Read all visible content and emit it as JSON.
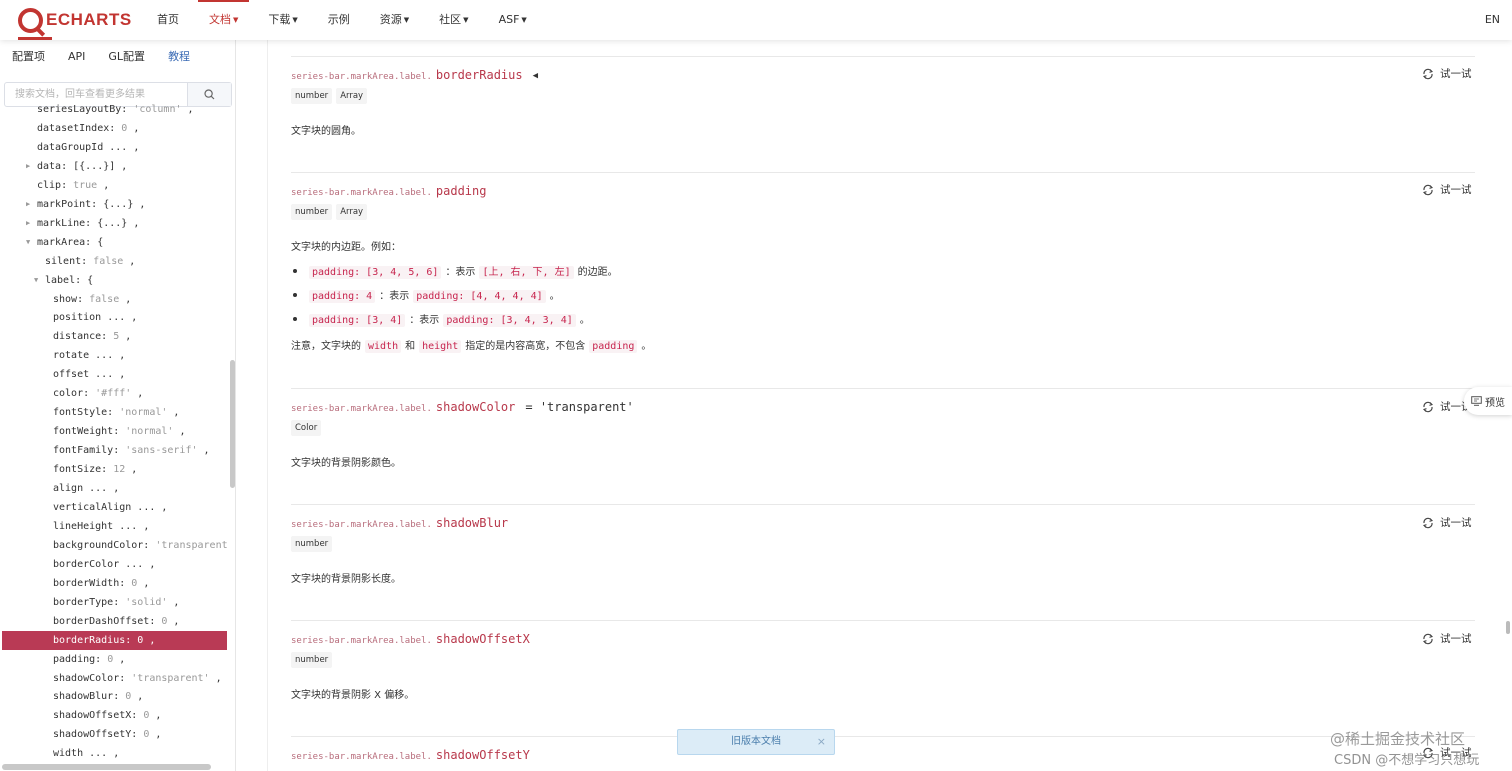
{
  "nav": {
    "logo_text": "ECHARTS",
    "items": [
      {
        "label": "首页",
        "has_caret": false
      },
      {
        "label": "文档",
        "has_caret": true
      },
      {
        "label": "下载",
        "has_caret": true
      },
      {
        "label": "示例",
        "has_caret": false
      },
      {
        "label": "资源",
        "has_caret": true
      },
      {
        "label": "社区",
        "has_caret": true
      },
      {
        "label": "ASF",
        "has_caret": true
      }
    ],
    "active_index": 1,
    "lang": "EN",
    "accent_color": "#c23531"
  },
  "sidebar": {
    "tabs": [
      "配置项",
      "API",
      "GL配置",
      "教程"
    ],
    "active_tab_index": 3,
    "search_placeholder": "搜索文档，回车查看更多结果",
    "tree": [
      {
        "key": "seriesLayoutBy:",
        "value": "'column'",
        "suffix": ",",
        "level": 0,
        "arrow": ""
      },
      {
        "key": "datasetIndex:",
        "value": "0",
        "suffix": ",",
        "level": 0,
        "arrow": ""
      },
      {
        "key": "dataGroupId",
        "value": "...",
        "suffix": ",",
        "level": 0,
        "arrow": ""
      },
      {
        "key": "data:",
        "value": "[{...}]",
        "suffix": ",",
        "level": 0,
        "arrow": "right"
      },
      {
        "key": "clip:",
        "value": "true",
        "suffix": ",",
        "level": 0,
        "arrow": ""
      },
      {
        "key": "markPoint:",
        "value": "{...}",
        "suffix": ",",
        "level": 0,
        "arrow": "right"
      },
      {
        "key": "markLine:",
        "value": "{...}",
        "suffix": ",",
        "level": 0,
        "arrow": "right"
      },
      {
        "key": "markArea:",
        "value": "{",
        "suffix": "",
        "level": 0,
        "arrow": "down"
      },
      {
        "key": "silent:",
        "value": "false",
        "suffix": ",",
        "level": 1,
        "arrow": ""
      },
      {
        "key": "label:",
        "value": "{",
        "suffix": "",
        "level": 1,
        "arrow": "down"
      },
      {
        "key": "show:",
        "value": "false",
        "suffix": ",",
        "level": 2,
        "arrow": ""
      },
      {
        "key": "position",
        "value": "...",
        "suffix": ",",
        "level": 2,
        "arrow": ""
      },
      {
        "key": "distance:",
        "value": "5",
        "suffix": ",",
        "level": 2,
        "arrow": ""
      },
      {
        "key": "rotate",
        "value": "...",
        "suffix": ",",
        "level": 2,
        "arrow": ""
      },
      {
        "key": "offset",
        "value": "...",
        "suffix": ",",
        "level": 2,
        "arrow": ""
      },
      {
        "key": "color:",
        "value": "'#fff'",
        "suffix": ",",
        "level": 2,
        "arrow": ""
      },
      {
        "key": "fontStyle:",
        "value": "'normal'",
        "suffix": ",",
        "level": 2,
        "arrow": ""
      },
      {
        "key": "fontWeight:",
        "value": "'normal'",
        "suffix": ",",
        "level": 2,
        "arrow": ""
      },
      {
        "key": "fontFamily:",
        "value": "'sans-serif'",
        "suffix": ",",
        "level": 2,
        "arrow": ""
      },
      {
        "key": "fontSize:",
        "value": "12",
        "suffix": ",",
        "level": 2,
        "arrow": ""
      },
      {
        "key": "align",
        "value": "...",
        "suffix": ",",
        "level": 2,
        "arrow": ""
      },
      {
        "key": "verticalAlign",
        "value": "...",
        "suffix": ",",
        "level": 2,
        "arrow": ""
      },
      {
        "key": "lineHeight",
        "value": "...",
        "suffix": ",",
        "level": 2,
        "arrow": ""
      },
      {
        "key": "backgroundColor:",
        "value": "'transparent'",
        "suffix": "",
        "level": 2,
        "arrow": ""
      },
      {
        "key": "borderColor",
        "value": "...",
        "suffix": ",",
        "level": 2,
        "arrow": ""
      },
      {
        "key": "borderWidth:",
        "value": "0",
        "suffix": ",",
        "level": 2,
        "arrow": ""
      },
      {
        "key": "borderType:",
        "value": "'solid'",
        "suffix": ",",
        "level": 2,
        "arrow": ""
      },
      {
        "key": "borderDashOffset:",
        "value": "0",
        "suffix": ",",
        "level": 2,
        "arrow": ""
      },
      {
        "key": "borderRadius:",
        "value": "0",
        "suffix": ",",
        "level": 2,
        "arrow": "",
        "selected": true
      },
      {
        "key": "padding:",
        "value": "0",
        "suffix": ",",
        "level": 2,
        "arrow": ""
      },
      {
        "key": "shadowColor:",
        "value": "'transparent'",
        "suffix": ",",
        "level": 2,
        "arrow": ""
      },
      {
        "key": "shadowBlur:",
        "value": "0",
        "suffix": ",",
        "level": 2,
        "arrow": ""
      },
      {
        "key": "shadowOffsetX:",
        "value": "0",
        "suffix": ",",
        "level": 2,
        "arrow": ""
      },
      {
        "key": "shadowOffsetY:",
        "value": "0",
        "suffix": ",",
        "level": 2,
        "arrow": ""
      },
      {
        "key": "width",
        "value": "...",
        "suffix": ",",
        "level": 2,
        "arrow": ""
      }
    ]
  },
  "content": {
    "path_prefix": "series-bar.markArea.label.",
    "try_label": "试一试",
    "sections": [
      {
        "name": "borderRadius",
        "default": "",
        "types": [
          "number",
          "Array"
        ],
        "desc": "文字块的圆角。",
        "pin": true
      },
      {
        "name": "padding",
        "default": "",
        "types": [
          "number",
          "Array"
        ],
        "desc": "文字块的内边距。例如：",
        "pin": false
      },
      {
        "name": "shadowColor",
        "default": "= 'transparent'",
        "types": [
          "Color"
        ],
        "desc": "文字块的背景阴影颜色。",
        "pin": false
      },
      {
        "name": "shadowBlur",
        "default": "",
        "types": [
          "number"
        ],
        "desc": "文字块的背景阴影长度。",
        "pin": false
      },
      {
        "name": "shadowOffsetX",
        "default": "",
        "types": [
          "number"
        ],
        "desc": "文字块的背景阴影 X 偏移。",
        "pin": false
      },
      {
        "name": "shadowOffsetY",
        "default": "",
        "types": [],
        "desc": "",
        "pin": false
      }
    ],
    "padding_bullets": [
      {
        "code1": "padding: [3, 4, 5, 6]",
        "text1": "：表示",
        "code2": "[上, 右, 下, 左]",
        "text2": "的边距。"
      },
      {
        "code1": "padding: 4",
        "text1": "：表示",
        "code2": "padding: [4, 4, 4, 4]",
        "text2": "。"
      },
      {
        "code1": "padding: [3, 4]",
        "text1": "：表示",
        "code2": "padding: [3, 4, 3, 4]",
        "text2": "。"
      }
    ],
    "padding_note": {
      "t1": "注意，文字块的",
      "c1": "width",
      "t2": "和",
      "c2": "height",
      "t3": "指定的是内容高宽，不包含",
      "c3": "padding",
      "t4": "。"
    }
  },
  "floating": {
    "preview_label": "预览",
    "old_doc_label": "旧版本文档",
    "old_doc_close": "×",
    "watermark_line1": "@稀土掘金技术社区",
    "watermark_line2": "CSDN @不想学习只想玩"
  }
}
